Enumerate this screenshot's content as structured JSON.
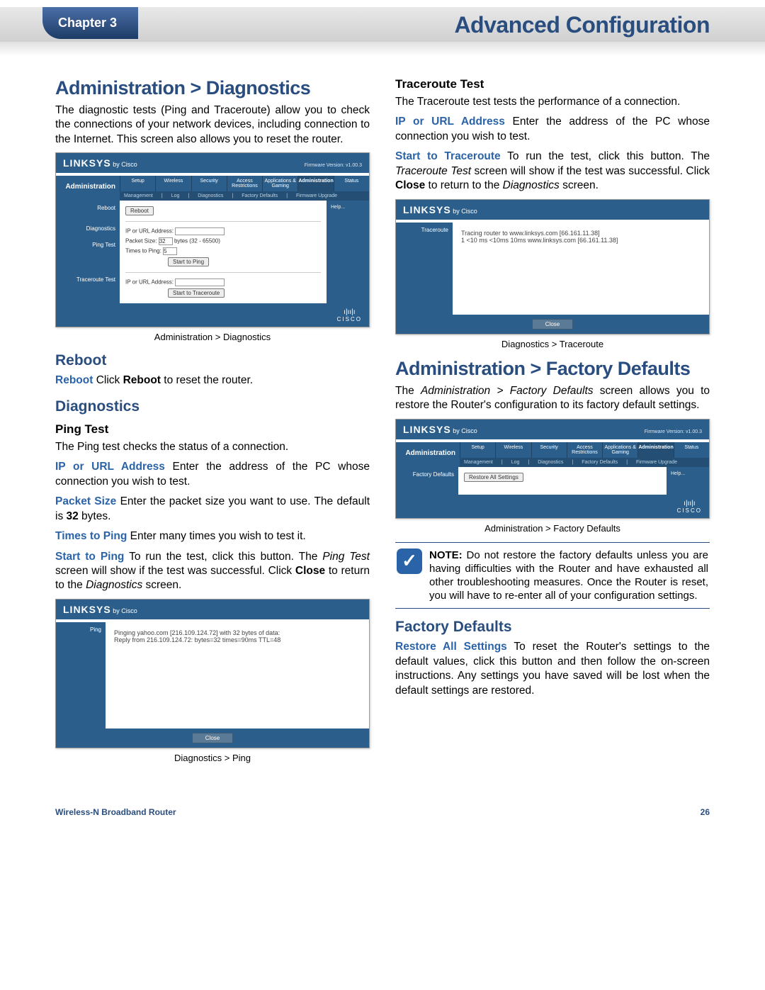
{
  "header": {
    "chapter": "Chapter 3",
    "title": "Advanced Configuration"
  },
  "left_column": {
    "section_title": "Administration > Diagnostics",
    "intro": "The diagnostic tests (Ping and Traceroute) allow you to check the connections of your network devices, including connection to the Internet. This screen also allows you to reset the router.",
    "diag_mock": {
      "brand": "LINKSYS",
      "brand_sub": "by Cisco",
      "fw": "Firmware Version: v1.00.3",
      "side_title": "Administration",
      "top_tabs": [
        "Setup",
        "Wireless",
        "Security",
        "Access Restrictions",
        "Applications & Gaming",
        "Administration",
        "Status"
      ],
      "sub_tabs": [
        "Management",
        "Log",
        "Diagnostics",
        "Factory Defaults",
        "Firmware Upgrade"
      ],
      "left_labels": {
        "reboot": "Reboot",
        "diagnostics": "Diagnostics",
        "ping": "Ping Test",
        "trace": "Traceroute Test"
      },
      "fields": {
        "reboot_btn": "Reboot",
        "ip_label1": "IP or URL Address:",
        "packet_label": "Packet Size:",
        "packet_val": "32",
        "packet_hint": "bytes (32 - 65500)",
        "times_label": "Times to Ping:",
        "times_val": "5",
        "start_ping": "Start to Ping",
        "ip_label2": "IP or URL Address:",
        "start_trace": "Start to Traceroute",
        "help": "Help..."
      },
      "cisco": "CISCO"
    },
    "caption1": "Administration > Diagnostics",
    "reboot_h": "Reboot",
    "reboot_term": "Reboot",
    "reboot_txt_a": "  Click ",
    "reboot_bold": "Reboot",
    "reboot_txt_b": " to reset the router.",
    "diag_h": "Diagnostics",
    "ping_h": "Ping Test",
    "ping_intro": "The Ping test checks the status of a connection.",
    "ip_term": "IP or URL Address",
    "ip_txt": "  Enter the address of the PC whose connection you wish to test.",
    "pkt_term": "Packet Size",
    "pkt_txt_a": "  Enter the packet size you want to use. The default is ",
    "pkt_bold": "32",
    "pkt_txt_b": " bytes.",
    "times_term": "Times to Ping",
    "times_txt": "  Enter many times you wish to test it.",
    "startping_term": "Start to Ping",
    "startping_txt_a": "  To run the test, click this button. The ",
    "startping_ital": "Ping Test",
    "startping_txt_b": " screen will show if the test was successful. Click ",
    "startping_bold": "Close",
    "startping_txt_c": " to return to the ",
    "startping_ital2": "Diagnostics",
    "startping_txt_d": " screen.",
    "ping_mock": {
      "brand": "LINKSYS",
      "brand_sub": "by Cisco",
      "side": "Ping",
      "line1": "Pinging yahoo.com [216.109.124.72] with 32 bytes of data:",
      "line2": "Reply from 216.109.124.72: bytes=32 times=90ms TTL=48",
      "close": "Close"
    },
    "caption2": "Diagnostics > Ping"
  },
  "right_column": {
    "trace_h": "Traceroute Test",
    "trace_intro": "The Traceroute test tests the performance of a connection.",
    "ip_term": "IP or URL Address",
    "ip_txt": "  Enter the address of the PC whose connection you wish to test.",
    "start_term": "Start to Traceroute",
    "start_txt_a": "  To run the test, click this button. The ",
    "start_ital": "Traceroute Test",
    "start_txt_b": " screen will show if the test was successful. Click ",
    "start_bold": "Close",
    "start_txt_c": " to return to the ",
    "start_ital2": "Diagnostics",
    "start_txt_d": " screen.",
    "trace_mock": {
      "brand": "LINKSYS",
      "brand_sub": "by Cisco",
      "side": "Traceroute",
      "line1": "Tracing router to www.linksys.com [66.161.11.38]",
      "line2": "1  <10 ms  <10ms  10ms  www.linksys.com [66.161.11.38]",
      "close": "Close"
    },
    "caption1": "Diagnostics > Traceroute",
    "fd_title": "Administration > Factory Defaults",
    "fd_intro_a": "The ",
    "fd_intro_ital": "Administration > Factory Defaults",
    "fd_intro_b": " screen allows you to restore the Router's configuration to its factory default settings.",
    "fd_mock": {
      "brand": "LINKSYS",
      "brand_sub": "by Cisco",
      "fw": "Firmware Version: v1.00.3",
      "side_title": "Administration",
      "top_tabs": [
        "Setup",
        "Wireless",
        "Security",
        "Access Restrictions",
        "Applications & Gaming",
        "Administration",
        "Status"
      ],
      "sub_tabs": [
        "Management",
        "Log",
        "Diagnostics",
        "Factory Defaults",
        "Firmware Upgrade"
      ],
      "left_label": "Factory Defaults",
      "restore_btn": "Restore All Settings",
      "help": "Help...",
      "cisco": "CISCO"
    },
    "caption2": "Administration > Factory Defaults",
    "note_label": "NOTE:",
    "note_txt": " Do not restore the factory defaults unless you are having difficulties with the Router and have exhausted all other troubleshooting measures. Once the Router is reset, you will have to re-enter all of your configuration settings.",
    "fd_h": "Factory Defaults",
    "restore_term": "Restore All Settings",
    "restore_txt": "  To reset the Router's settings to the default values, click this button and then follow the on-screen instructions. Any settings you have saved will be lost when the default settings are restored."
  },
  "footer": {
    "product": "Wireless-N Broadband Router",
    "page": "26"
  }
}
